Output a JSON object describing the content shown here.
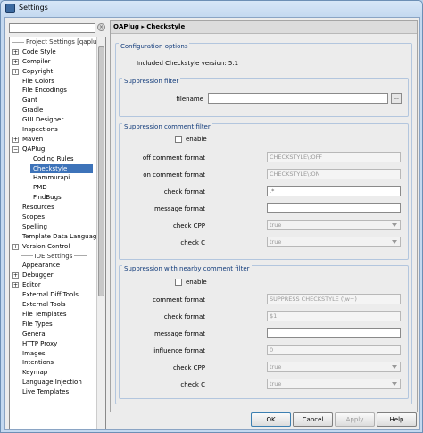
{
  "window": {
    "title": "Settings"
  },
  "search": {
    "value": "",
    "clear_glyph": "×"
  },
  "tree": {
    "items": [
      {
        "label": "Project Settings [qaplug]",
        "kind": "header"
      },
      {
        "label": "Code Style",
        "expander": "+"
      },
      {
        "label": "Compiler",
        "expander": "+"
      },
      {
        "label": "Copyright",
        "expander": "+"
      },
      {
        "label": "File Colors"
      },
      {
        "label": "File Encodings"
      },
      {
        "label": "Gant"
      },
      {
        "label": "Gradle"
      },
      {
        "label": "GUI Designer"
      },
      {
        "label": "Inspections"
      },
      {
        "label": "Maven",
        "expander": "+"
      },
      {
        "label": "QAPlug",
        "expander": "−"
      },
      {
        "label": "Coding Rules",
        "level": 1
      },
      {
        "label": "Checkstyle",
        "level": 1,
        "selected": true
      },
      {
        "label": "Hammurapi",
        "level": 1
      },
      {
        "label": "PMD",
        "level": 1
      },
      {
        "label": "FindBugs",
        "level": 1
      },
      {
        "label": "Resources"
      },
      {
        "label": "Scopes"
      },
      {
        "label": "Spelling"
      },
      {
        "label": "Template Data Languag..."
      },
      {
        "label": "Version Control",
        "expander": "+"
      },
      {
        "label": "IDE Settings",
        "kind": "header"
      },
      {
        "label": "Appearance"
      },
      {
        "label": "Debugger",
        "expander": "+"
      },
      {
        "label": "Editor",
        "expander": "+"
      },
      {
        "label": "External Diff Tools"
      },
      {
        "label": "External Tools"
      },
      {
        "label": "File Templates"
      },
      {
        "label": "File Types"
      },
      {
        "label": "General"
      },
      {
        "label": "HTTP Proxy"
      },
      {
        "label": "Images"
      },
      {
        "label": "Intentions"
      },
      {
        "label": "Keymap"
      },
      {
        "label": "Language Injection"
      },
      {
        "label": "Live Templates"
      }
    ]
  },
  "breadcrumb": {
    "root": "QAPlug",
    "separator": "▸",
    "leaf": "Checkstyle"
  },
  "config": {
    "title": "Configuration options",
    "version_text": "Included Checkstyle version: 5.1"
  },
  "suppression_filter": {
    "title": "Suppression filter",
    "filename_label": "filename",
    "filename_value": "",
    "browse_label": "..."
  },
  "comment_filter": {
    "title": "Suppression comment filter",
    "enable_label": "enable",
    "off_label": "off comment format",
    "off_value": "CHECKSTYLE\\:OFF",
    "on_label": "on comment format",
    "on_value": "CHECKSTYLE\\:ON",
    "check_format_label": "check format",
    "check_format_value": ".*",
    "message_format_label": "message format",
    "message_format_value": "",
    "check_cpp_label": "check CPP",
    "check_cpp_value": "true",
    "check_c_label": "check C",
    "check_c_value": "true"
  },
  "nearby_filter": {
    "title": "Suppression with nearby comment filter",
    "enable_label": "enable",
    "comment_format_label": "comment format",
    "comment_format_value": "SUPPRESS CHECKSTYLE (\\w+)",
    "check_format_label": "check format",
    "check_format_value": "$1",
    "message_format_label": "message format",
    "message_format_value": "",
    "influence_format_label": "influence format",
    "influence_format_value": "0",
    "check_cpp_label": "check CPP",
    "check_cpp_value": "true",
    "check_c_label": "check C",
    "check_c_value": "true"
  },
  "buttons": {
    "ok": "OK",
    "cancel": "Cancel",
    "apply": "Apply",
    "help": "Help"
  },
  "colors": {
    "selection": "#3d73b9",
    "group_title": "#103a7a",
    "title_bar": "#c4d9f0"
  }
}
